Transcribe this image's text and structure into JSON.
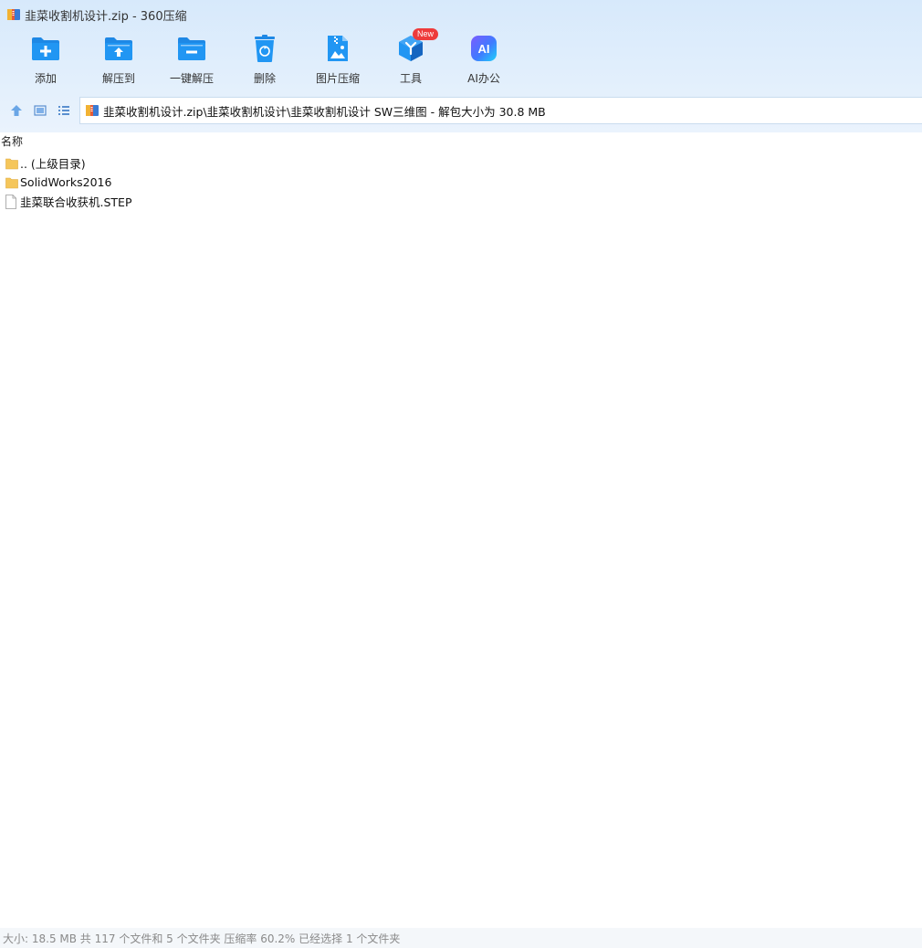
{
  "window": {
    "title": "韭菜收割机设计.zip - 360压缩"
  },
  "toolbar": {
    "items": [
      {
        "id": "add",
        "label": "添加",
        "icon": "add-folder-icon"
      },
      {
        "id": "extract-to",
        "label": "解压到",
        "icon": "extract-folder-icon"
      },
      {
        "id": "one-click",
        "label": "一键解压",
        "icon": "one-click-extract-icon"
      },
      {
        "id": "delete",
        "label": "删除",
        "icon": "recycle-bin-icon"
      },
      {
        "id": "image-compress",
        "label": "图片压缩",
        "icon": "image-compress-icon"
      },
      {
        "id": "tools",
        "label": "工具",
        "icon": "tools-cube-icon",
        "badge": "New"
      },
      {
        "id": "ai-office",
        "label": "AI办公",
        "icon": "ai-office-icon",
        "glyph": "AI"
      }
    ]
  },
  "nav": {
    "path": "韭菜收割机设计.zip\\韭菜收割机设计\\韭菜收割机设计 SW三维图 - 解包大小为 30.8 MB"
  },
  "list": {
    "column_name": "名称",
    "items": [
      {
        "name": ".. (上级目录)",
        "type": "folder"
      },
      {
        "name": "SolidWorks2016",
        "type": "folder"
      },
      {
        "name": "韭菜联合收获机.STEP",
        "type": "file"
      }
    ]
  },
  "status": {
    "text": "大小: 18.5 MB 共 117 个文件和 5 个文件夹 压缩率 60.2% 已经选择 1 个文件夹"
  },
  "colors": {
    "accent": "#1e88e5",
    "badge": "#ee3b3b",
    "folder": "#f5c65a"
  }
}
